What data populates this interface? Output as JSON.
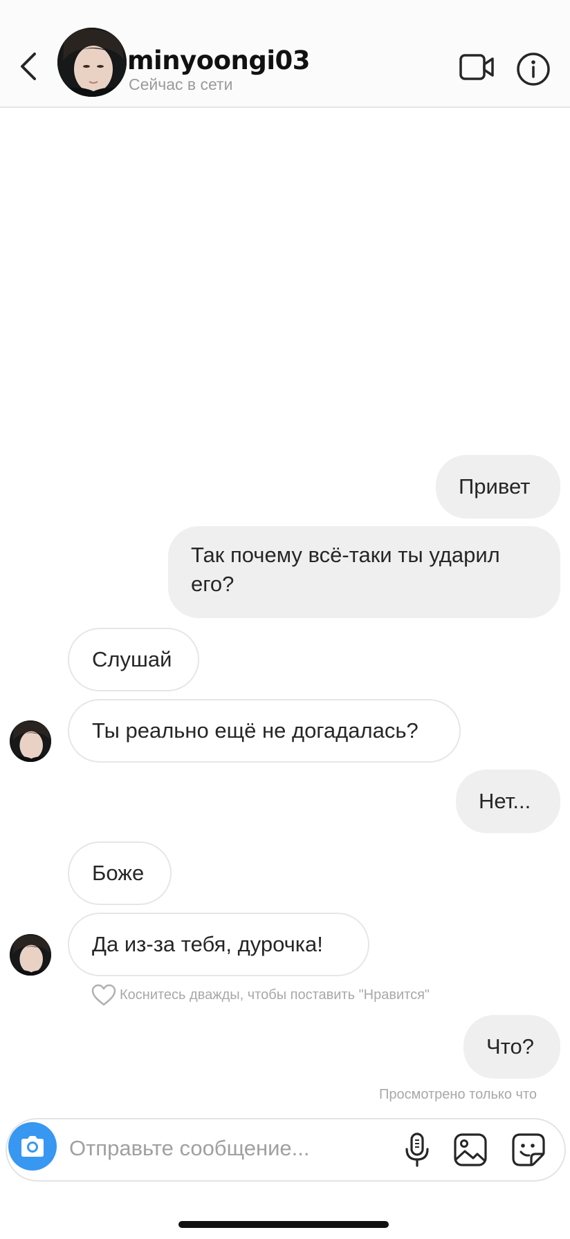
{
  "header": {
    "username": "minyoongi03",
    "status": "Сейчас в сети",
    "icons": {
      "back": "chevron-left-icon",
      "video": "video-camera-icon",
      "info": "info-icon"
    }
  },
  "messages": [
    {
      "id": "m1",
      "direction": "outgoing",
      "text": "Привет"
    },
    {
      "id": "m2",
      "direction": "outgoing",
      "text": "Так почему всё-таки ты ударил его?"
    },
    {
      "id": "m3",
      "direction": "incoming",
      "text": "Слушай"
    },
    {
      "id": "m4",
      "direction": "incoming",
      "text": "Ты реально ещё не догадалась?"
    },
    {
      "id": "m5",
      "direction": "outgoing",
      "text": "Нет..."
    },
    {
      "id": "m6",
      "direction": "incoming",
      "text": "Боже"
    },
    {
      "id": "m7",
      "direction": "incoming",
      "text": "Да из-за тебя, дурочка!"
    },
    {
      "id": "m8",
      "direction": "outgoing",
      "text": "Что?"
    }
  ],
  "like_hint": "Коснитесь дважды, чтобы поставить \"Нравится\"",
  "seen_status": "Просмотрено только что",
  "composer": {
    "placeholder": "Отправьте сообщение...",
    "icons": {
      "camera": "camera-icon",
      "mic": "microphone-icon",
      "gallery": "image-gallery-icon",
      "sticker": "sticker-icon"
    }
  },
  "colors": {
    "accent": "#3897f0",
    "outgoing_bubble": "#efefef",
    "incoming_border": "#e6e6e6",
    "muted_text": "#a8a8a8"
  }
}
